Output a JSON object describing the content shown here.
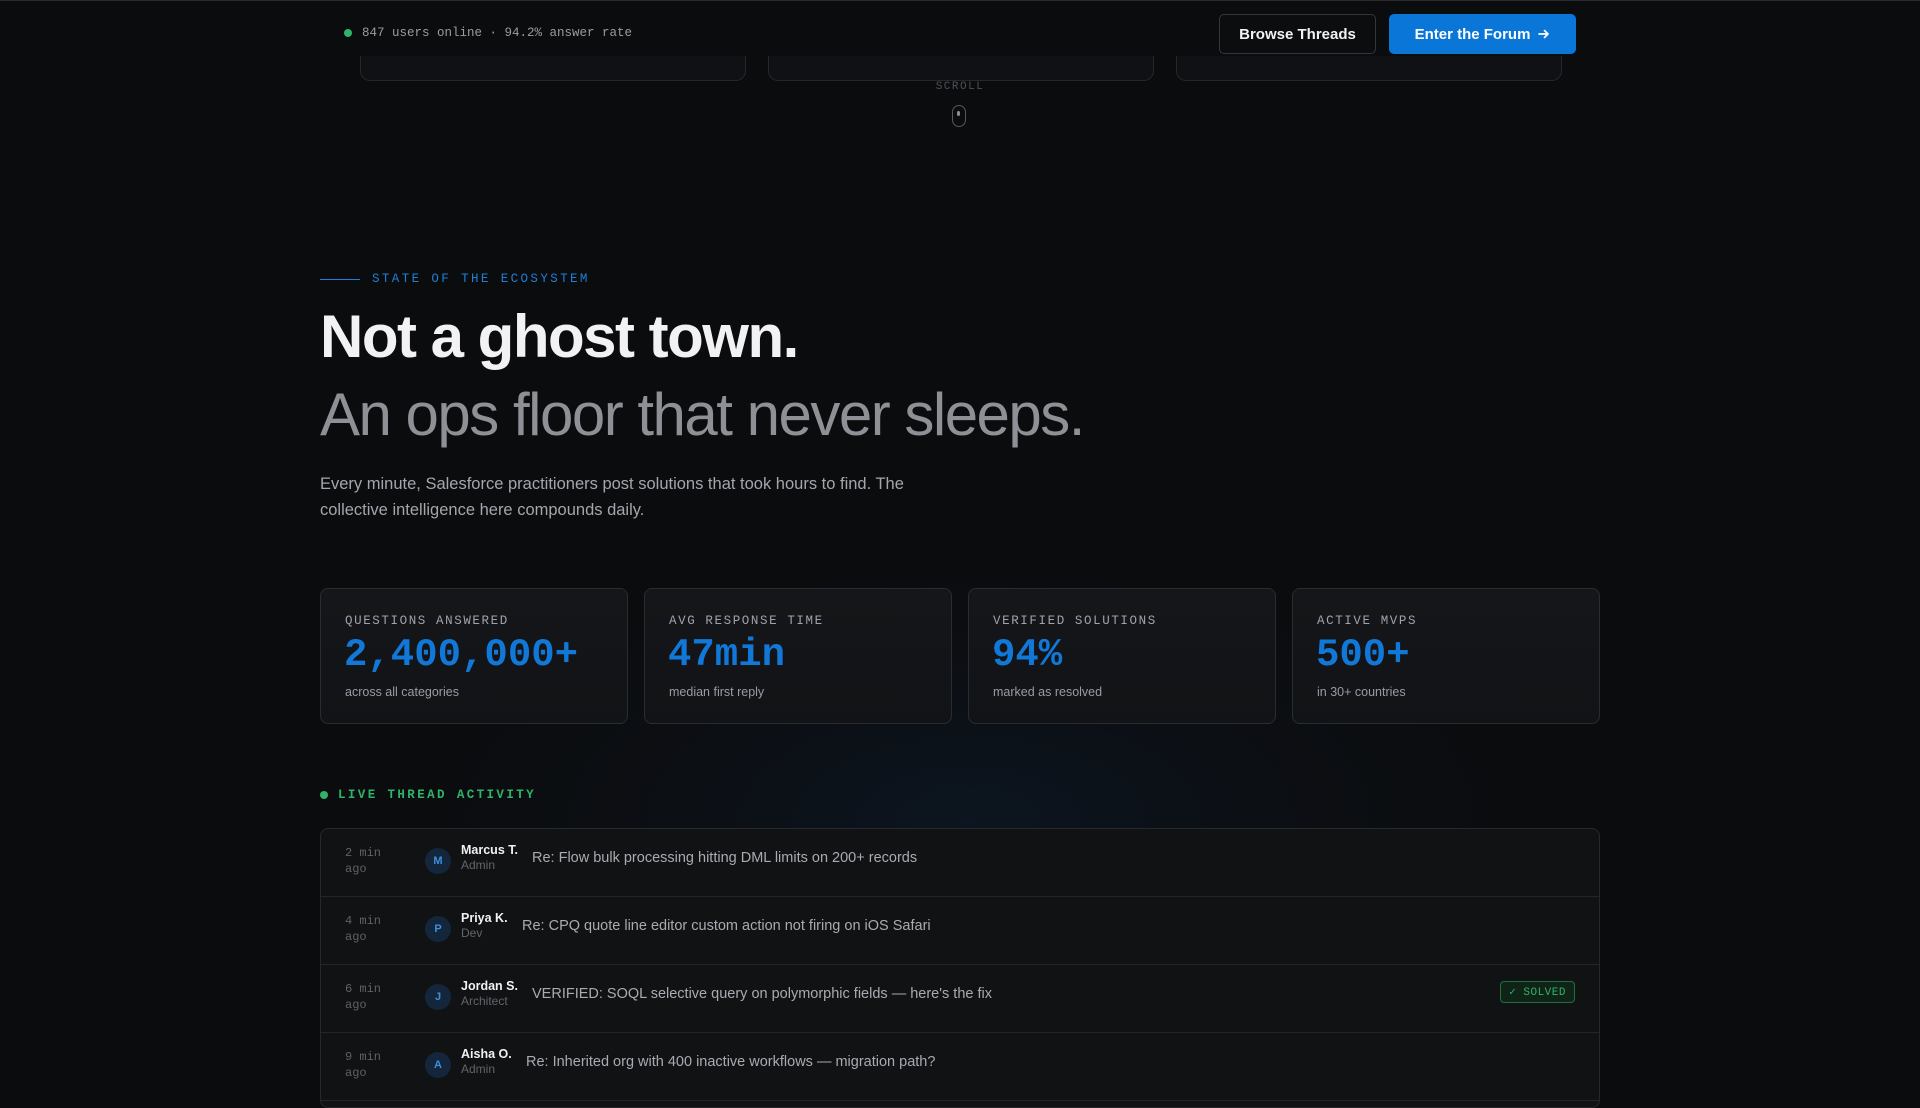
{
  "header": {
    "status_text": "847 users online · 94.2% answer rate",
    "browse_label": "Browse Threads",
    "enter_label": "Enter the Forum",
    "scroll_label": "SCROLL"
  },
  "hero": {
    "eyebrow": "STATE OF THE ECOSYSTEM",
    "title": "Not a ghost town.",
    "subtitle": "An ops floor that never sleeps.",
    "lead": "Every minute, Salesforce practitioners post solutions that took hours to find. The collective intelligence here compounds daily."
  },
  "stats": [
    {
      "label": "QUESTIONS ANSWERED",
      "value": "2,400,000+",
      "sub": "across all categories"
    },
    {
      "label": "AVG RESPONSE TIME",
      "value": "47min",
      "sub": "median first reply"
    },
    {
      "label": "VERIFIED SOLUTIONS",
      "value": "94%",
      "sub": "marked as resolved"
    },
    {
      "label": "ACTIVE MVPS",
      "value": "500+",
      "sub": "in 30+ countries"
    }
  ],
  "activity": {
    "title": "LIVE THREAD ACTIVITY",
    "rows": [
      {
        "time": "2 min ago",
        "initial": "M",
        "name": "Marcus T.",
        "role": "Admin",
        "text": "Re: Flow bulk processing hitting DML limits on 200+ records",
        "badge": ""
      },
      {
        "time": "4 min ago",
        "initial": "P",
        "name": "Priya K.",
        "role": "Dev",
        "text": "Re: CPQ quote line editor custom action not firing on iOS Safari",
        "badge": ""
      },
      {
        "time": "6 min ago",
        "initial": "J",
        "name": "Jordan S.",
        "role": "Architect",
        "text": "VERIFIED: SOQL selective query on polymorphic fields — here's the fix",
        "badge": "✓ SOLVED"
      },
      {
        "time": "9 min ago",
        "initial": "A",
        "name": "Aisha O.",
        "role": "Admin",
        "text": "Re: Inherited org with 400 inactive workflows — migration path?",
        "badge": ""
      }
    ]
  },
  "colors": {
    "accent": "#0a76d8",
    "stat_value": "#1178d8",
    "live_green": "#2fb36a",
    "background": "#0b0c0e"
  },
  "icons": {
    "status": "online-dot-icon",
    "enter_arrow": "arrow-right-icon",
    "scroll": "mouse-scroll-icon"
  }
}
